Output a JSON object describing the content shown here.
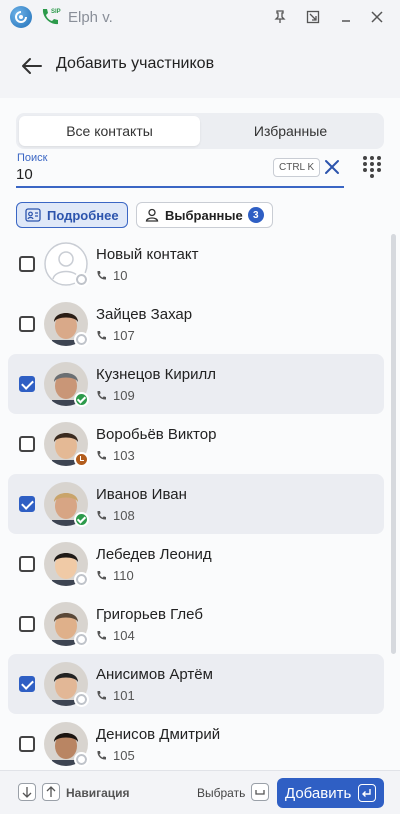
{
  "titlebar": {
    "app_title": "Elph v.",
    "sip_badge": "SIP"
  },
  "header": {
    "title": "Добавить участников"
  },
  "tabs": [
    {
      "label": "Все контакты",
      "active": true
    },
    {
      "label": "Избранные",
      "active": false
    }
  ],
  "search": {
    "label": "Поиск",
    "value": "10",
    "shortcut": "CTRL K"
  },
  "filters": {
    "details_label": "Подробнее",
    "selected_label": "Выбранные",
    "selected_count": "3"
  },
  "contacts": [
    {
      "name": "Новый контакт",
      "ext": "10",
      "checked": false,
      "status": "offline",
      "placeholder_avatar": true
    },
    {
      "name": "Зайцев Захар",
      "ext": "107",
      "checked": false,
      "status": "offline"
    },
    {
      "name": "Кузнецов Кирилл",
      "ext": "109",
      "checked": true,
      "status": "online"
    },
    {
      "name": "Воробьёв Виктор",
      "ext": "103",
      "checked": false,
      "status": "away"
    },
    {
      "name": "Иванов Иван",
      "ext": "108",
      "checked": true,
      "status": "online"
    },
    {
      "name": "Лебедев Леонид",
      "ext": "110",
      "checked": false,
      "status": "offline"
    },
    {
      "name": "Григорьев Глеб",
      "ext": "104",
      "checked": false,
      "status": "offline"
    },
    {
      "name": "Анисимов Артём",
      "ext": "101",
      "checked": true,
      "status": "offline"
    },
    {
      "name": "Денисов Дмитрий",
      "ext": "105",
      "checked": false,
      "status": "offline"
    }
  ],
  "footer": {
    "nav_label": "Навигация",
    "select_label": "Выбрать",
    "add_label": "Добавить"
  },
  "colors": {
    "accent": "#2f5fc4",
    "online": "#2c9a4b",
    "away": "#b35d1d"
  }
}
